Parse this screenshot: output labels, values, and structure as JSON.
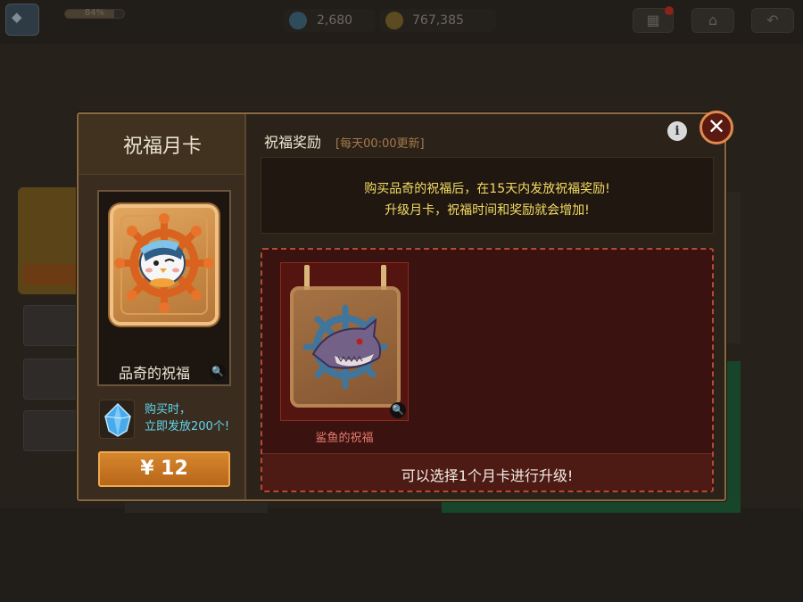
{
  "hud": {
    "xp_percent": 84,
    "xp_label": "84%",
    "gems": "2,680",
    "gold": "767,385",
    "menu_icon": "grid-icon",
    "home_icon": "home-icon",
    "back_icon": "back-arrow-icon"
  },
  "modal": {
    "card_title": "祝福月卡",
    "card_name": "品奇的祝福",
    "gem_note_line1": "购买时，",
    "gem_note_line2": "立即发放200个!",
    "price": "¥ 12",
    "reward_title": "祝福奖励",
    "reward_subtitle": "[每天00:00更新]",
    "info_label": "i",
    "close_label": "✕",
    "notice_line1": "购买品奇的祝福后，在15天内发放祝福奖励!",
    "notice_line2": "升级月卡，祝福时间和奖励就会增加!",
    "upgrade_card_name": "鲨鱼的祝福",
    "upgrade_hint": "可以选择1个月卡进行升级!",
    "magnifier_icon": "🔍"
  },
  "colors": {
    "accent_orange": "#c97b26",
    "notice_yellow": "#f5dc63",
    "gem_cyan": "#5fd7f2",
    "upgrade_red": "#e67b6f"
  }
}
